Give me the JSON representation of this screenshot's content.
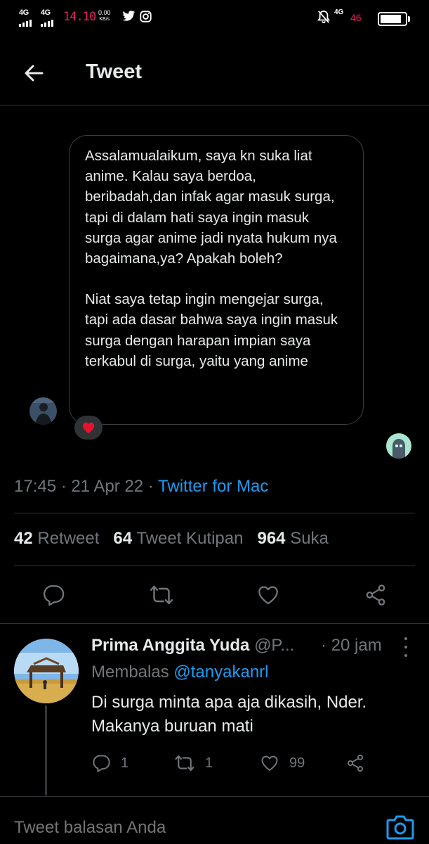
{
  "status_bar": {
    "net1": "4G",
    "net2": "4G",
    "time": "14.10",
    "speed_value": "0.00",
    "speed_unit": "KB/s",
    "right_net": "4G",
    "right_sub": "46",
    "battery_level": 0.85,
    "icons": [
      "twitter-icon",
      "instagram-icon",
      "mute-icon",
      "battery-icon"
    ]
  },
  "header": {
    "title": "Tweet",
    "back_icon": "arrow-left-icon"
  },
  "dm": {
    "paragraph1": "Assalamualaikum, saya kn suka liat anime. Kalau saya berdoa, beribadah,dan infak agar masuk surga, tapi di dalam hati saya ingin masuk surga agar anime jadi nyata hukum nya bagaimana,ya? Apakah boleh?",
    "paragraph2": "Niat saya tetap ingin mengejar surga, tapi ada dasar bahwa saya ingin masuk surga dengan harapan impian saya terkabul di surga, yaitu yang anime",
    "reaction": "❤️"
  },
  "tweet_meta": {
    "time": "17:45",
    "date": "21 Apr 22",
    "source": "Twitter for Mac"
  },
  "stats": {
    "retweets_count": "42",
    "retweets_label": "Retweet",
    "quotes_count": "64",
    "quotes_label": "Tweet Kutipan",
    "likes_count": "964",
    "likes_label": "Suka"
  },
  "actions": [
    "reply-icon",
    "retweet-icon",
    "like-icon",
    "share-icon"
  ],
  "reply": {
    "name": "Prima Anggita Yuda",
    "handle": "@P...",
    "time": "· 20 jam",
    "replying_prefix": "Membalas",
    "replying_to": "@tanyakanrl",
    "text": "Di surga minta apa aja dikasih, Nder. Makanya buruan mati",
    "reply_count": "1",
    "retweet_count": "1",
    "like_count": "99"
  },
  "composer": {
    "placeholder": "Tweet balasan Anda"
  },
  "colors": {
    "background": "#000000",
    "accent": "#1d9bf0",
    "muted": "#71767b",
    "text": "#e7e9ea",
    "status_red": "#e0245e"
  }
}
